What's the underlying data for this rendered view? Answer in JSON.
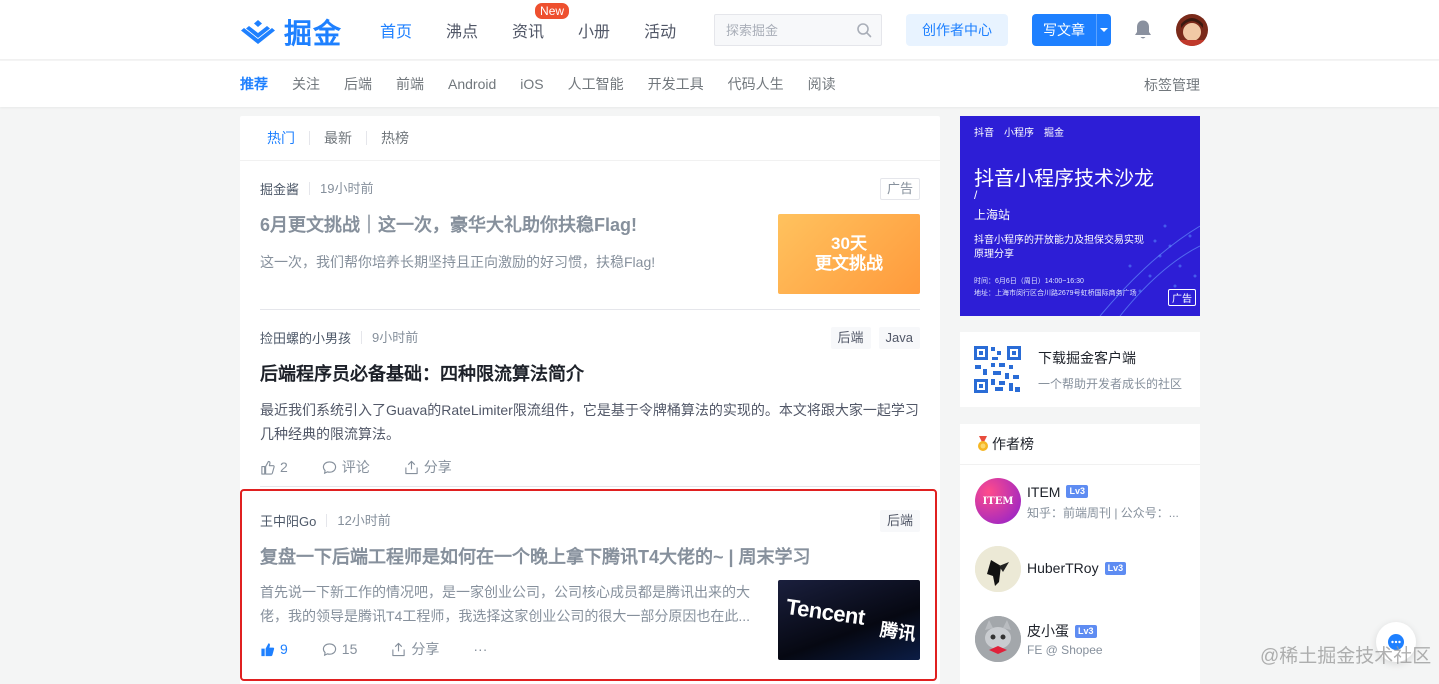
{
  "brand": {
    "name": "掘金"
  },
  "nav": {
    "items": [
      "首页",
      "沸点",
      "资讯",
      "小册",
      "活动"
    ],
    "new_badge": "New",
    "search_placeholder": "探索掘金",
    "creator_center": "创作者中心",
    "write_article": "写文章"
  },
  "subnav": {
    "tabs": [
      "推荐",
      "关注",
      "后端",
      "前端",
      "Android",
      "iOS",
      "人工智能",
      "开发工具",
      "代码人生",
      "阅读"
    ],
    "manage": "标签管理"
  },
  "feed": {
    "tabs": [
      "热门",
      "最新",
      "热榜"
    ],
    "entries": [
      {
        "author": "掘金酱",
        "time": "19小时前",
        "ad_label": "广告",
        "title": "6月更文挑战｜这一次，豪华大礼助你扶稳Flag!",
        "abstract": "这一次，我们帮你培养长期坚持且正向激励的好习惯，扶稳Flag!",
        "thumb_text": [
          "30天",
          "更文挑战"
        ]
      },
      {
        "author": "捡田螺的小男孩",
        "time": "9小时前",
        "tags": [
          "后端",
          "Java"
        ],
        "title": "后端程序员必备基础：四种限流算法简介",
        "abstract": "最近我们系统引入了Guava的RateLimiter限流组件，它是基于令牌桶算法的实现的。本文将跟大家一起学习几种经典的限流算法。",
        "likes": "2",
        "comments": "评论",
        "share": "分享"
      },
      {
        "author": "王中阳Go",
        "time": "12小时前",
        "tags": [
          "后端"
        ],
        "title": "复盘一下后端工程师是如何在一个晚上拿下腾讯T4大佬的~ | 周末学习",
        "abstract": "首先说一下新工作的情况吧，是一家创业公司，公司核心成员都是腾讯出来的大佬，我的领导是腾讯T4工程师，我选择这家创业公司的很大一部分原因也在此...",
        "likes": "9",
        "comments": "15",
        "share": "分享",
        "more": "···",
        "thumb_text": [
          "Tencent",
          "腾讯"
        ]
      }
    ]
  },
  "sidebar": {
    "ad": {
      "brands": [
        "抖音",
        "小程序",
        "掘金"
      ],
      "title": "抖音小程序技术沙龙",
      "slash": "/",
      "city": "上海站",
      "desc": [
        "抖音小程序的开放能力及担保交易实现",
        "原理分享"
      ],
      "time": "时间：6月6日（周日）14:00~16:30",
      "address": "地址：上海市闵行区合川路2679号虹桥国际商务广场",
      "ad_label": "广告"
    },
    "app": {
      "title": "下载掘金客户端",
      "subtitle": "一个帮助开发者成长的社区"
    },
    "authors_title": "作者榜",
    "authors": [
      {
        "name": "ITEM",
        "level": "Lv3",
        "desc": "知乎：前端周刊 | 公众号：...",
        "avatar_text": "ITEM"
      },
      {
        "name": "HuberTRoy",
        "level": "Lv3",
        "desc": ""
      },
      {
        "name": "皮小蛋",
        "level": "Lv3",
        "desc": "FE @ Shopee"
      }
    ]
  },
  "watermark": "@稀土掘金技术社区",
  "colors": {
    "brand": "#1e80ff",
    "highlight": "#e02020"
  }
}
